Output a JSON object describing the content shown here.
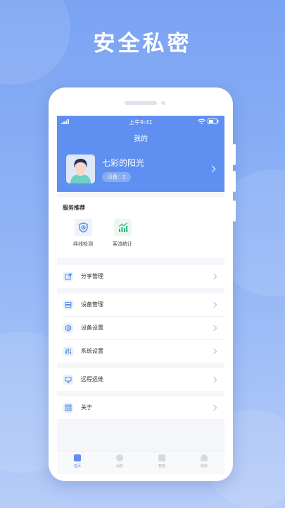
{
  "headline": "安全私密",
  "status_bar": {
    "time": "上午9:41"
  },
  "header": {
    "title": "我的"
  },
  "profile": {
    "name": "七彩的阳光",
    "device_badge": "设备：2"
  },
  "services": {
    "title": "服务推荐",
    "items": [
      {
        "label": "绊线检测",
        "icon": "shield-target-icon"
      },
      {
        "label": "客流统计",
        "icon": "bar-chart-icon"
      }
    ]
  },
  "menu": {
    "share": "分享管理",
    "device_manage": "设备管理",
    "device_settings": "设备设置",
    "system_settings": "系统设置",
    "remote_ops": "远程运维",
    "about": "关于"
  },
  "tabbar": {
    "home": "首页",
    "messages": "消息",
    "smart": "智能",
    "mine": "我的"
  },
  "colors": {
    "accent": "#5f8ff0",
    "background_top": "#7aa3f3",
    "background_bottom": "#b6ccf8"
  }
}
